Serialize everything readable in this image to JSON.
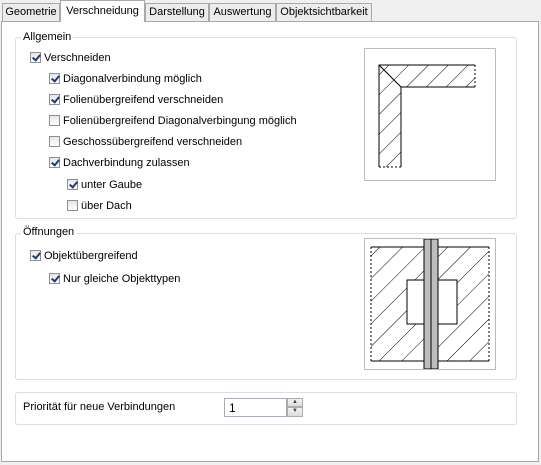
{
  "tabs": [
    {
      "label": "Geometrie"
    },
    {
      "label": "Verschneidung"
    },
    {
      "label": "Darstellung"
    },
    {
      "label": "Auswertung"
    },
    {
      "label": "Objektsichtbarkeit"
    }
  ],
  "active_tab": "Verschneidung",
  "allgemein": {
    "title": "Allgemein",
    "options": [
      {
        "label": "Verschneiden",
        "checked": true
      },
      {
        "label": "Diagonalverbindung möglich",
        "checked": true
      },
      {
        "label": "Folienübergreifend verschneiden",
        "checked": true
      },
      {
        "label": "Folienübergreifend Diagonalverbingung möglich",
        "checked": false
      },
      {
        "label": "Geschossübergreifend verschneiden",
        "checked": false
      },
      {
        "label": "Dachverbindung zulassen",
        "checked": true
      },
      {
        "label": "unter Gaube",
        "checked": true
      },
      {
        "label": "über Dach",
        "checked": false
      }
    ]
  },
  "oeffnungen": {
    "title": "Öffnungen",
    "options": [
      {
        "label": "Objektübergreifend",
        "checked": true
      },
      {
        "label": "Nur gleiche Objekttypen",
        "checked": true
      }
    ]
  },
  "prioritaet": {
    "label": "Priorität für neue Verbindungen",
    "value": "1"
  },
  "icons": {
    "spin_up": "spin-up-icon",
    "spin_down": "spin-down-icon",
    "corner_preview": "wall-corner-preview-icon",
    "opening_preview": "wall-opening-preview-icon"
  }
}
